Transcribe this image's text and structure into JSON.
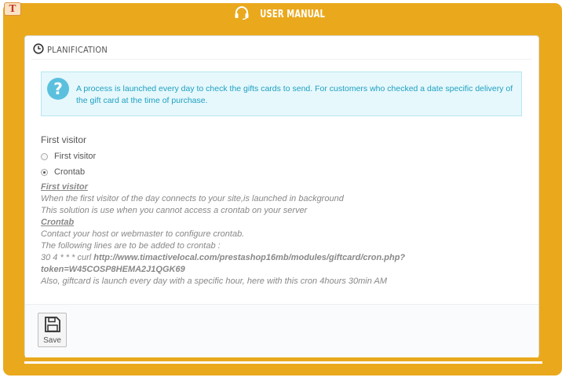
{
  "header": {
    "title": "USER MANUAL",
    "icon": "headset-icon",
    "corner_logo": "T"
  },
  "panel": {
    "heading": "PLANIFICATION",
    "alert": {
      "text": "A process is launched every day to check the gifts cards to send. For customers who checked a date specific delivery of the gift card at the time of purchase."
    },
    "field_label": "First visitor",
    "options": [
      {
        "label": "First visitor",
        "checked": false
      },
      {
        "label": "Crontab",
        "checked": true
      }
    ],
    "help": {
      "first_visitor_title": "First visitor",
      "first_visitor_line1": "When the first visitor of the day connects to your site,is launched in background",
      "first_visitor_line2": "This solution is use when you cannot access a crontab on your server",
      "crontab_title": "Crontab",
      "crontab_line1": "Contact your host or webmaster to configure crontab.",
      "crontab_line2": "The following lines are to be added to crontab :",
      "cron_prefix": "30 4 * * * curl ",
      "cron_url": "http://www.timactivelocal.com/prestashop16mb/modules/giftcard/cron.php?",
      "cron_token": "token=W45COSP8HEMA2J1QGK69",
      "crontab_line3": "Also, giftcard is launch every day with a specific hour, here with this cron 4hours 30min AM"
    },
    "save_label": "Save"
  },
  "colors": {
    "accent": "#eaa91d",
    "info": "#5bc0de",
    "info_text": "#1e9fc0"
  }
}
